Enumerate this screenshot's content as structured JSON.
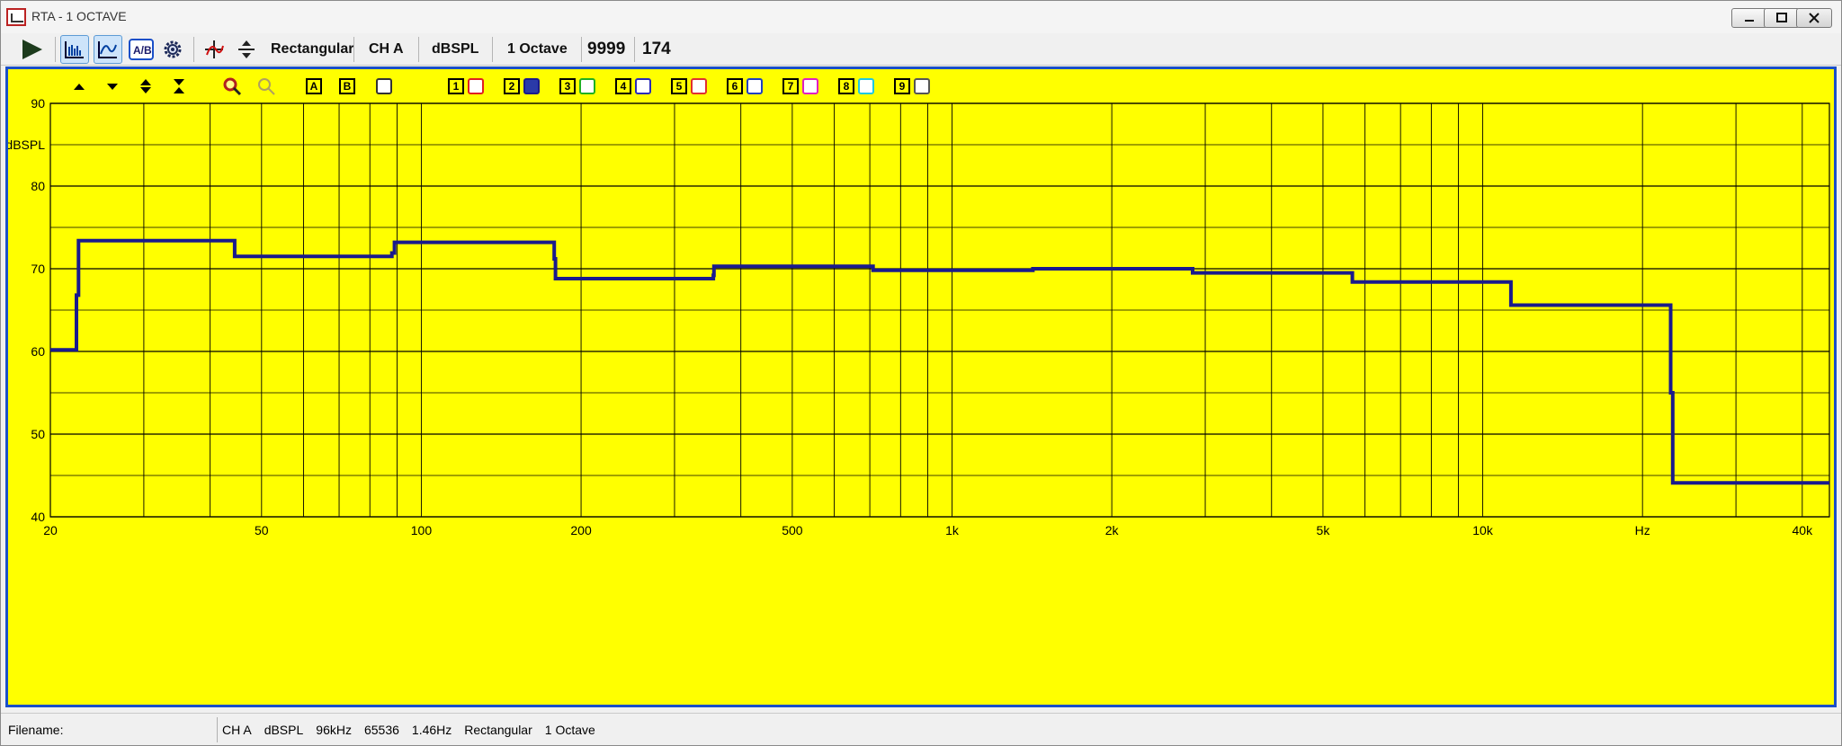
{
  "window": {
    "title": "RTA - 1 OCTAVE",
    "controls": [
      "minimize",
      "maximize",
      "close"
    ]
  },
  "toolbar": {
    "window_type": "Rectangular",
    "channel": "CH A",
    "units": "dBSPL",
    "resolution": "1 Octave",
    "averages": "9999",
    "count": "174"
  },
  "plot_controls": {
    "store_a": "A",
    "store_b": "B",
    "traces": [
      {
        "label": "1",
        "color": "#e02020"
      },
      {
        "label": "2",
        "color": "#1a1a8c"
      },
      {
        "label": "3",
        "color": "#20b020"
      },
      {
        "label": "4",
        "color": "#2b2bb8"
      },
      {
        "label": "5",
        "color": "#e03030"
      },
      {
        "label": "6",
        "color": "#2040c0"
      },
      {
        "label": "7",
        "color": "#e020c0"
      },
      {
        "label": "8",
        "color": "#20c8e0"
      },
      {
        "label": "9",
        "color": "#555555"
      }
    ]
  },
  "chart_data": {
    "type": "line",
    "title": "",
    "xlabel": "",
    "ylabel": "dBSPL",
    "x_unit_label": "Hz",
    "xscale": "log",
    "xlim": [
      20,
      45000
    ],
    "ylim": [
      40,
      90
    ],
    "y_ticks": [
      40,
      50,
      60,
      70,
      80,
      90
    ],
    "x_tick_labels": [
      {
        "x": 20,
        "label": "20"
      },
      {
        "x": 50,
        "label": "50"
      },
      {
        "x": 100,
        "label": "100"
      },
      {
        "x": 200,
        "label": "200"
      },
      {
        "x": 500,
        "label": "500"
      },
      {
        "x": 1000,
        "label": "1k"
      },
      {
        "x": 2000,
        "label": "2k"
      },
      {
        "x": 5000,
        "label": "5k"
      },
      {
        "x": 10000,
        "label": "10k"
      },
      {
        "x": 20000,
        "label": "Hz"
      },
      {
        "x": 40000,
        "label": "40k"
      }
    ],
    "grid": true,
    "background": "#ffff00",
    "series": [
      {
        "color": "#1a1a8c",
        "points": [
          [
            20,
            60.2
          ],
          [
            22.4,
            60.2
          ],
          [
            22.4,
            66.8
          ],
          [
            22.6,
            66.8
          ],
          [
            22.6,
            73.4
          ],
          [
            44.5,
            73.4
          ],
          [
            44.5,
            71.5
          ],
          [
            88,
            71.5
          ],
          [
            88,
            71.9
          ],
          [
            89,
            71.9
          ],
          [
            89,
            73.2
          ],
          [
            178,
            73.2
          ],
          [
            178,
            71.2
          ],
          [
            179,
            71.2
          ],
          [
            179,
            68.8
          ],
          [
            355,
            68.8
          ],
          [
            355,
            69.2
          ],
          [
            356,
            69.2
          ],
          [
            356,
            70.3
          ],
          [
            710,
            70.3
          ],
          [
            710,
            69.8
          ],
          [
            1420,
            69.8
          ],
          [
            1420,
            70.0
          ],
          [
            2840,
            70.0
          ],
          [
            2840,
            69.5
          ],
          [
            5680,
            69.5
          ],
          [
            5680,
            68.4
          ],
          [
            11300,
            68.4
          ],
          [
            11300,
            65.6
          ],
          [
            22600,
            65.6
          ],
          [
            22600,
            55.0
          ],
          [
            22800,
            55.0
          ],
          [
            22800,
            44.1
          ],
          [
            45000,
            44.1
          ]
        ]
      }
    ]
  },
  "statusbar": {
    "filename_label": "Filename:",
    "channel": "CH A",
    "units": "dBSPL",
    "sample_rate": "96kHz",
    "fft_size": "65536",
    "bin_width": "1.46Hz",
    "window": "Rectangular",
    "resolution": "1 Octave"
  }
}
